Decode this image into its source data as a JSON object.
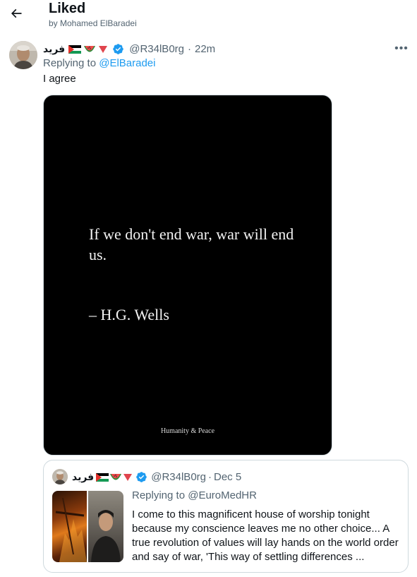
{
  "header": {
    "title": "Liked",
    "subtitle": "by Mohamed ElBaradei"
  },
  "tweet": {
    "display_name": "فريد",
    "handle": "@R34lB0rg",
    "time": "22m",
    "reply_prefix": "Replying to",
    "reply_to": "@ElBaradei",
    "text": "I agree",
    "media": {
      "quote": "If we don't end war, war will end us.",
      "author": "– H.G. Wells",
      "footer": "Humanity & Peace"
    },
    "more_label": "•••"
  },
  "quoted_tweet": {
    "display_name": "فريد",
    "handle": "@R34lB0rg",
    "time": "Dec 5",
    "reply_line": "Replying to @EuroMedHR",
    "text": "I come to this magnificent house of worship tonight because my conscience leaves me no other choice... A true revolution of values will lay hands on the world order and say of war, 'This way of settling differences ..."
  },
  "colors": {
    "link": "#1d9bf0",
    "secondary_text": "#536471",
    "verified": "#1d9bf0"
  }
}
